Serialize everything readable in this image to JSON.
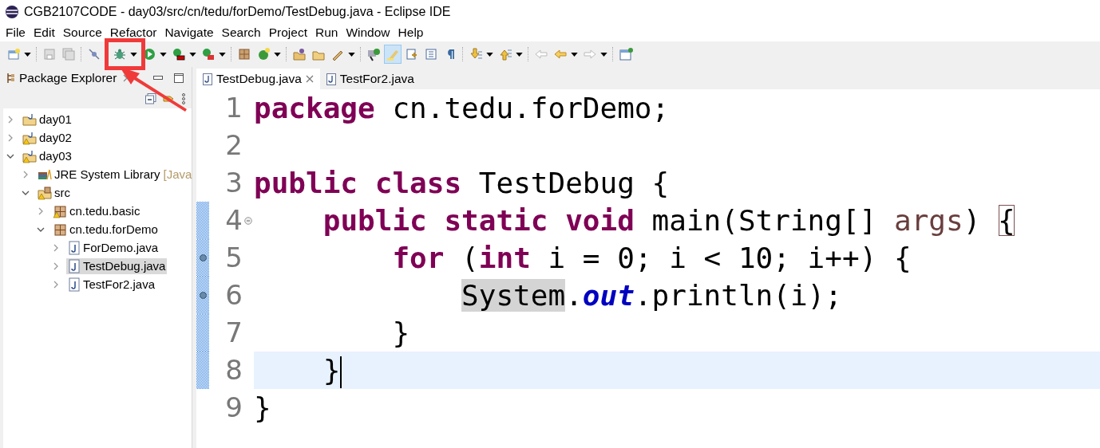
{
  "window": {
    "title": "CGB2107CODE - day03/src/cn/tedu/forDemo/TestDebug.java - Eclipse IDE"
  },
  "menu": [
    "File",
    "Edit",
    "Source",
    "Refactor",
    "Navigate",
    "Search",
    "Project",
    "Run",
    "Window",
    "Help"
  ],
  "toolbar": [
    {
      "kind": "new",
      "selected": false,
      "dropdown": true,
      "annotated": false
    },
    {
      "kind": "save",
      "selected": false,
      "dropdown": false,
      "annotated": false
    },
    {
      "kind": "save-all",
      "selected": false,
      "dropdown": false,
      "annotated": false
    },
    {
      "kind": "breakpoints",
      "selected": false,
      "dropdown": false,
      "annotated": false
    },
    {
      "kind": "debug",
      "selected": false,
      "dropdown": true,
      "annotated": true
    },
    {
      "kind": "run",
      "selected": false,
      "dropdown": true,
      "annotated": false
    },
    {
      "kind": "coverage",
      "selected": false,
      "dropdown": true,
      "annotated": false
    },
    {
      "kind": "external",
      "selected": false,
      "dropdown": true,
      "annotated": false
    },
    {
      "kind": "package",
      "selected": false,
      "dropdown": false,
      "annotated": false
    },
    {
      "kind": "class",
      "selected": false,
      "dropdown": true,
      "annotated": false
    },
    {
      "kind": "open-project",
      "selected": false,
      "dropdown": false,
      "annotated": false
    },
    {
      "kind": "open-folder",
      "selected": false,
      "dropdown": false,
      "annotated": false
    },
    {
      "kind": "pen",
      "selected": false,
      "dropdown": true,
      "annotated": false
    },
    {
      "kind": "task",
      "selected": false,
      "dropdown": false,
      "annotated": false
    },
    {
      "kind": "highlight",
      "selected": true,
      "dropdown": false,
      "annotated": false
    },
    {
      "kind": "block",
      "selected": false,
      "dropdown": false,
      "annotated": false
    },
    {
      "kind": "list",
      "selected": false,
      "dropdown": false,
      "annotated": false
    },
    {
      "kind": "pilcrow",
      "selected": false,
      "dropdown": false,
      "annotated": false
    },
    {
      "kind": "next",
      "selected": false,
      "dropdown": true,
      "annotated": false
    },
    {
      "kind": "prev",
      "selected": false,
      "dropdown": true,
      "annotated": false
    },
    {
      "kind": "back-grey",
      "selected": false,
      "dropdown": false,
      "annotated": false
    },
    {
      "kind": "back",
      "selected": false,
      "dropdown": true,
      "annotated": false
    },
    {
      "kind": "forward",
      "selected": false,
      "dropdown": true,
      "annotated": false
    },
    {
      "kind": "perspective",
      "selected": false,
      "dropdown": false,
      "annotated": false
    }
  ],
  "package_explorer": {
    "title": "Package Explorer",
    "tree": [
      {
        "label": "day01",
        "kind": "project",
        "warning": false,
        "expanded": false,
        "selected": false
      },
      {
        "label": "day02",
        "kind": "project",
        "warning": true,
        "expanded": false,
        "selected": false
      },
      {
        "label": "day03",
        "kind": "project",
        "warning": true,
        "expanded": true,
        "selected": false,
        "children": [
          {
            "label": "JRE System Library",
            "suffix": "[Java",
            "kind": "library",
            "warning": false,
            "expanded": false,
            "selected": false
          },
          {
            "label": "src",
            "kind": "source",
            "warning": true,
            "expanded": true,
            "selected": false,
            "children": [
              {
                "label": "cn.tedu.basic",
                "kind": "package",
                "warning": true,
                "expanded": false,
                "selected": false
              },
              {
                "label": "cn.tedu.forDemo",
                "kind": "package",
                "warning": false,
                "expanded": true,
                "selected": false,
                "children": [
                  {
                    "label": "ForDemo.java",
                    "kind": "file",
                    "warning": false,
                    "expanded": false,
                    "selected": false
                  },
                  {
                    "label": "TestDebug.java",
                    "kind": "file",
                    "warning": false,
                    "expanded": false,
                    "selected": true
                  },
                  {
                    "label": "TestFor2.java",
                    "kind": "file",
                    "warning": false,
                    "expanded": false,
                    "selected": false
                  }
                ]
              }
            ]
          }
        ]
      }
    ]
  },
  "editor": {
    "tabs": [
      {
        "label": "TestDebug.java",
        "selected": true,
        "closable": true
      },
      {
        "label": "TestFor2.java",
        "selected": false,
        "closable": false
      }
    ],
    "lines": [
      {
        "number": "1",
        "current": false,
        "fold": false,
        "in_range": false,
        "occurrence": false,
        "caret": false,
        "tokens": [
          {
            "text": "package",
            "kind": "keyword"
          },
          {
            "text": " cn.tedu.forDemo;",
            "kind": "plain"
          }
        ]
      },
      {
        "number": "2",
        "current": false,
        "fold": false,
        "in_range": false,
        "occurrence": false,
        "caret": false
      },
      {
        "number": "3",
        "current": false,
        "fold": false,
        "in_range": false,
        "occurrence": false,
        "caret": false,
        "tokens": [
          {
            "text": "public class",
            "kind": "keyword"
          },
          {
            "text": " TestDebug {",
            "kind": "plain"
          }
        ]
      },
      {
        "number": "4",
        "current": false,
        "fold": true,
        "in_range": true,
        "occurrence": false,
        "caret": false,
        "tokens": [
          {
            "text": "    public static void",
            "kind": "keyword"
          },
          {
            "text": " main(String[] ",
            "kind": "plain"
          },
          {
            "text": "args",
            "kind": "param"
          },
          {
            "text": ") ",
            "kind": "plain"
          },
          {
            "text": "{",
            "kind": "bracket-match"
          }
        ]
      },
      {
        "number": "5",
        "current": false,
        "fold": false,
        "in_range": true,
        "occurrence": true,
        "caret": false,
        "tokens": [
          {
            "text": "        for",
            "kind": "keyword"
          },
          {
            "text": " (",
            "kind": "plain"
          },
          {
            "text": "int",
            "kind": "keyword"
          },
          {
            "text": " i = 0; i < 10; i++) {",
            "kind": "plain"
          }
        ]
      },
      {
        "number": "6",
        "current": false,
        "fold": false,
        "in_range": true,
        "occurrence": true,
        "caret": false,
        "tokens": [
          {
            "text": "            System",
            "kind": "highlighted"
          },
          {
            "text": ".",
            "kind": "plain"
          },
          {
            "text": "out",
            "kind": "field"
          },
          {
            "text": ".println(i);",
            "kind": "plain"
          }
        ]
      },
      {
        "number": "7",
        "current": false,
        "fold": false,
        "in_range": true,
        "occurrence": false,
        "caret": false,
        "tokens": [
          {
            "text": "        }",
            "kind": "plain"
          }
        ]
      },
      {
        "number": "8",
        "current": true,
        "fold": false,
        "in_range": true,
        "occurrence": false,
        "caret": true,
        "tokens": [
          {
            "text": "    }",
            "kind": "plain"
          }
        ]
      },
      {
        "number": "9",
        "current": false,
        "fold": false,
        "in_range": false,
        "occurrence": false,
        "caret": false,
        "tokens": [
          {
            "text": "}",
            "kind": "plain"
          }
        ]
      }
    ]
  }
}
